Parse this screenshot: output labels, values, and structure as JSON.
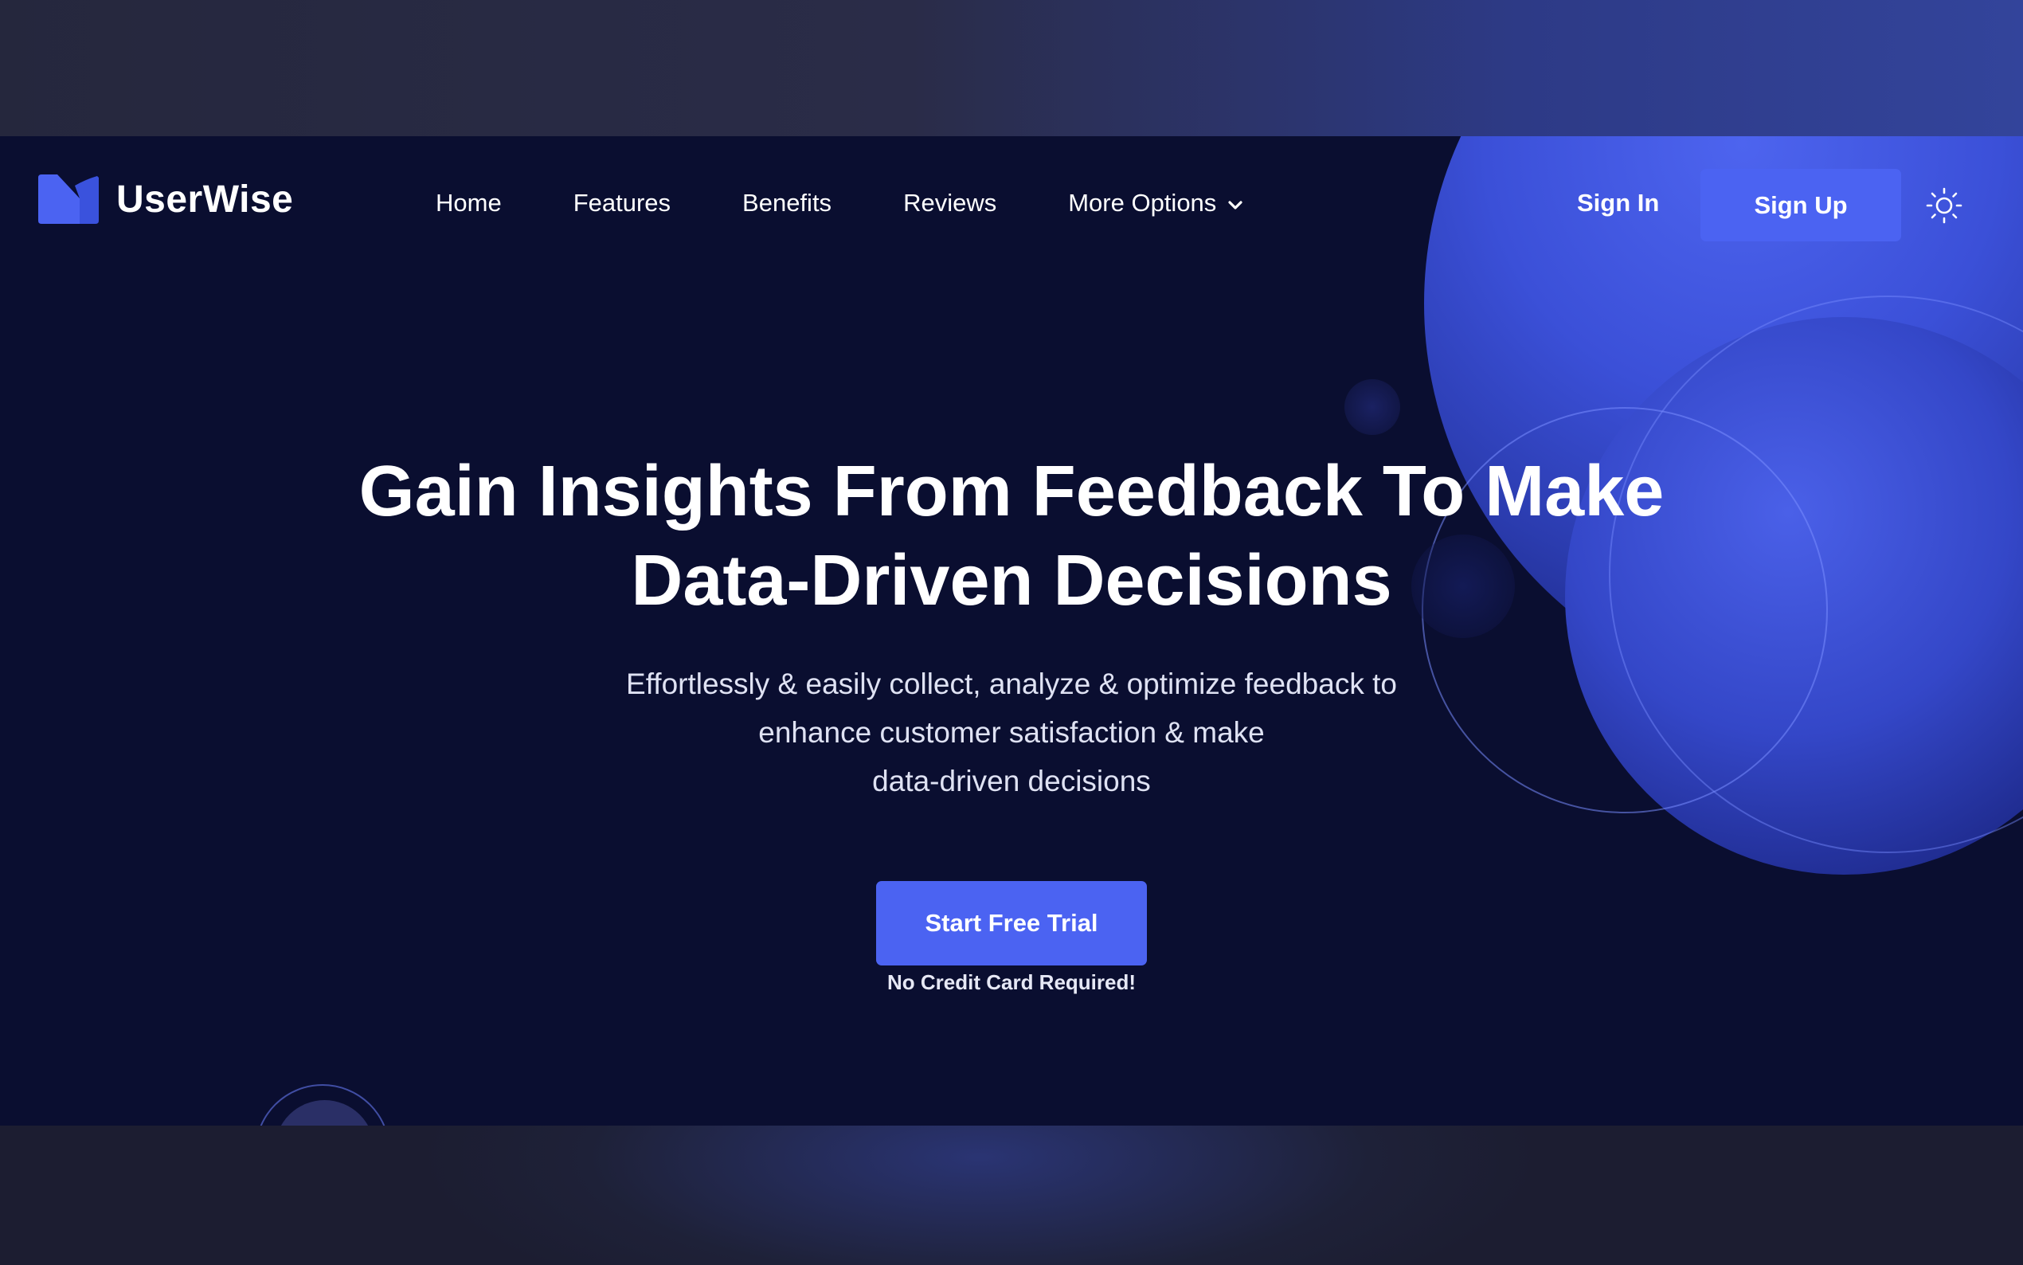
{
  "brand": {
    "name": "UserWise",
    "accent": "#4b63f2",
    "background": "#0a0e30"
  },
  "nav": {
    "links": [
      {
        "label": "Home"
      },
      {
        "label": "Features"
      },
      {
        "label": "Benefits"
      },
      {
        "label": "Reviews"
      },
      {
        "label": "More Options",
        "icon": "chevron-down-icon"
      }
    ],
    "sign_in": "Sign In",
    "sign_up": "Sign Up",
    "theme_icon": "sun-icon"
  },
  "hero": {
    "headline_line1": "Gain Insights From Feedback To Make",
    "headline_line2": "Data-Driven Decisions",
    "sub_line1": "Effortlessly & easily collect, analyze & optimize feedback to",
    "sub_line2": "enhance customer satisfaction & make",
    "sub_line3": "data-driven decisions",
    "cta_label": "Start Free Trial",
    "cta_note": "No Credit Card Required!"
  }
}
